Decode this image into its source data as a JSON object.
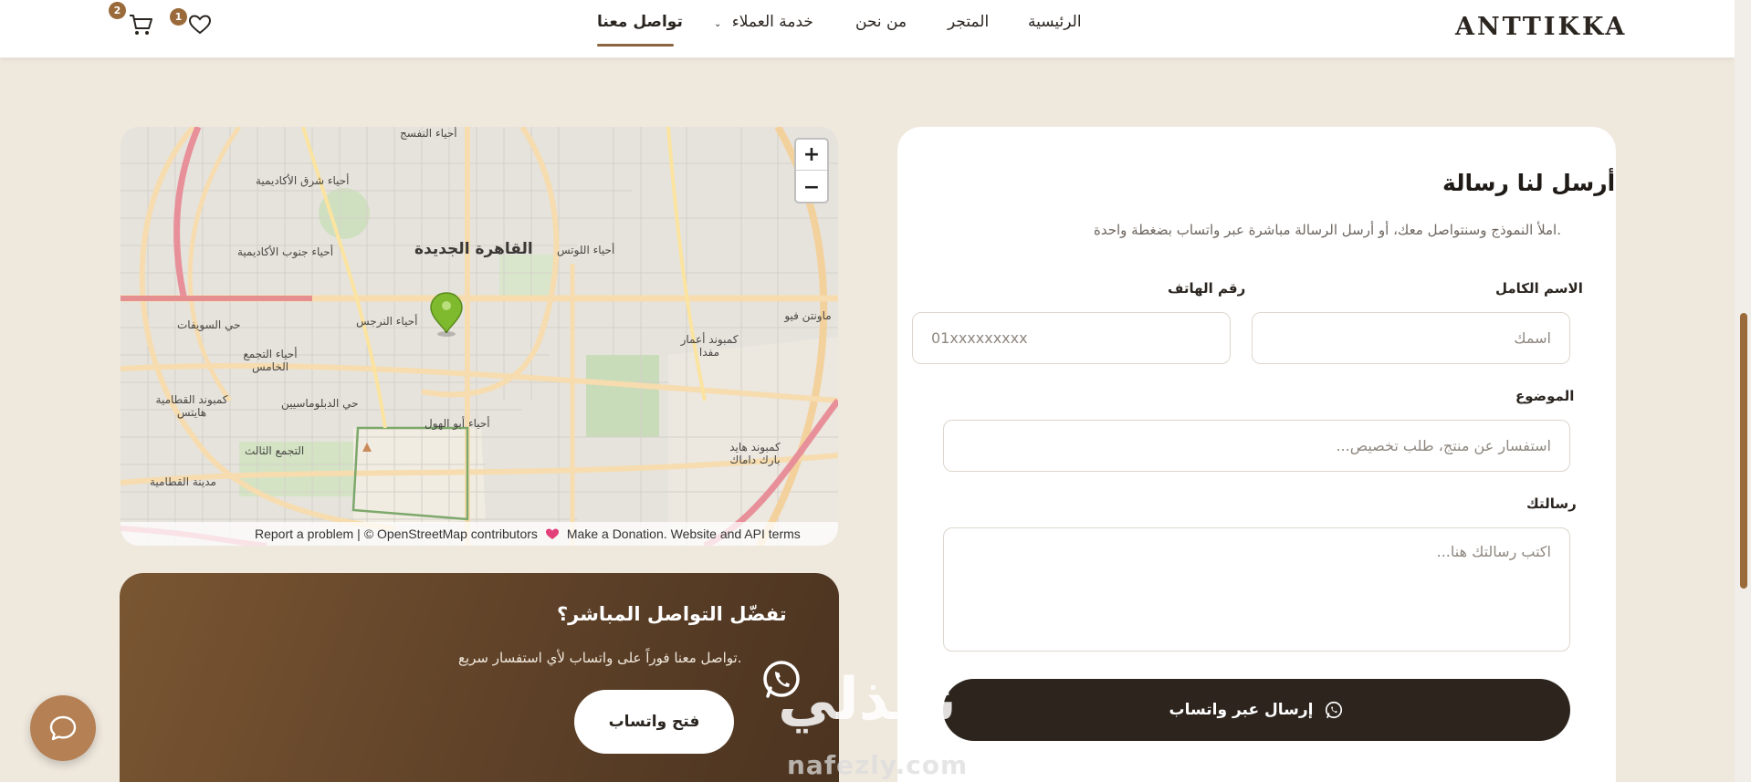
{
  "header": {
    "logo": "ANTTIKKA",
    "nav": [
      {
        "label": "الرئيسية"
      },
      {
        "label": "المتجر"
      },
      {
        "label": "من نحن"
      },
      {
        "label": "خدمة العملاء"
      },
      {
        "label": "تواصل معنا"
      }
    ],
    "wishlist_count": "1",
    "cart_count": "2",
    "icons": [
      "heart-icon",
      "cart-icon",
      "chevron-down-icon"
    ]
  },
  "form": {
    "title": "أرسل لنا رسالة",
    "subtitle": "املأ النموذج وسنتواصل معك، أو أرسل الرسالة مباشرة عبر واتساب بضغطة واحدة.",
    "name_label": "الاسم الكامل",
    "name_placeholder": "اسمك",
    "phone_label": "رقم الهاتف",
    "phone_placeholder": "01xxxxxxxxx",
    "subject_label": "الموضوع",
    "subject_placeholder": "استفسار عن منتج، طلب تخصيص...",
    "message_label": "رسالتك",
    "message_placeholder": "اكتب رسالتك هنا...",
    "submit_label": "إرسال عبر واتساب"
  },
  "map": {
    "labels": [
      "أحياء النفسج",
      "أحياء شرق الأكاديمية",
      "أحياء جنوب الأكاديمية",
      "القاهرة الجديدة",
      "أحياء اللوتس",
      "حي السويفات",
      "أحياء النرجس",
      "أحياء التجمع الخامس",
      "كمبوند القطامية هايتس",
      "حي الدبلوماسيين",
      "أحياء أبو الهول",
      "التجمع الثالث",
      "مدينة القطامية",
      "كمبوند أعمار مفدا",
      "كمبوند هايد بارك داماك",
      "ماونتن فيو"
    ],
    "zoom_in": "+",
    "zoom_out": "−",
    "attribution": {
      "report": "Report a problem",
      "sep": "|",
      "osm": "© OpenStreetMap contributors",
      "donate": "Make a Donation.",
      "terms": "Website and API terms"
    }
  },
  "whatsapp": {
    "title": "تفضّل التواصل المباشر؟",
    "subtitle": "تواصل معنا فوراً على واتساب لأي استفسار سريع.",
    "button_label": "فتح واتساب"
  },
  "watermark": {
    "arabic": "نفذلي",
    "latin": "nafezly.com"
  },
  "colors": {
    "page_bg": "#efe8dd",
    "accent": "#9a6a3a",
    "dark_button": "#2c241d",
    "card_gradient_start": "#7a5632",
    "card_gradient_end": "#4a3320"
  }
}
